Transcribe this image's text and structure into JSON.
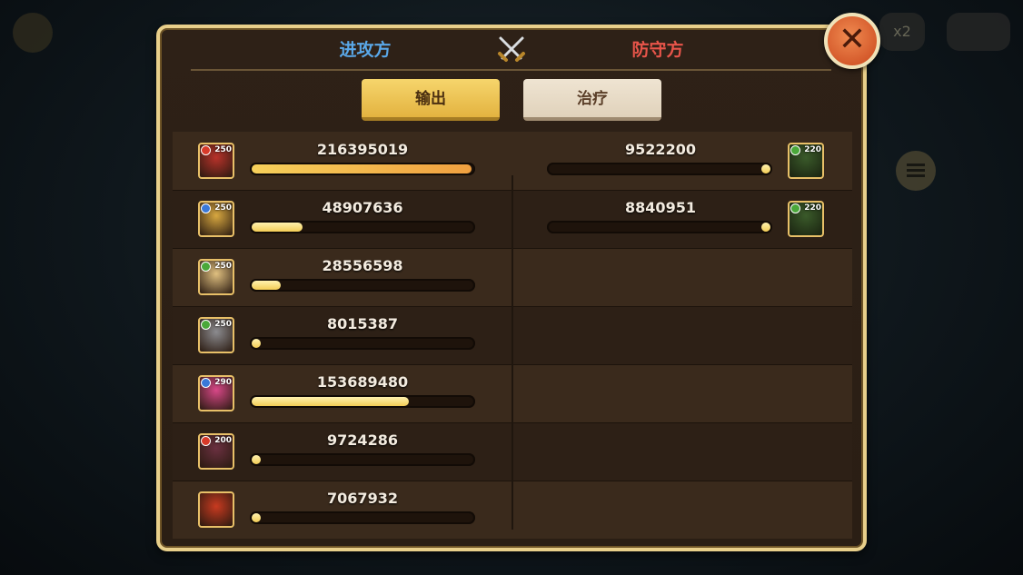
{
  "header": {
    "attacker_label": "进攻方",
    "defender_label": "防守方",
    "vs_icon": "crossed-swords-icon",
    "close_icon": "close-x-icon"
  },
  "background": {
    "speed_label": "x2"
  },
  "tabs": [
    {
      "label": "输出",
      "selected": true
    },
    {
      "label": "治疗",
      "selected": false
    }
  ],
  "attackers": [
    {
      "damage": "216395019",
      "level": "250",
      "element": "fire",
      "portrait_color": "#b8322a",
      "fill_fraction": 0.99,
      "fill_color": "#f0a040"
    },
    {
      "damage": "48907636",
      "level": "250",
      "element": "light",
      "portrait_color": "#d8a840",
      "fill_fraction": 0.23
    },
    {
      "damage": "28556598",
      "level": "250",
      "element": "nature",
      "portrait_color": "#e0c080",
      "fill_fraction": 0.13
    },
    {
      "damage": "8015387",
      "level": "250",
      "element": "nature",
      "portrait_color": "#8c8c90",
      "fill_fraction": 0.04
    },
    {
      "damage": "153689480",
      "level": "290",
      "element": "light",
      "portrait_color": "#d84888",
      "fill_fraction": 0.71
    },
    {
      "damage": "9724286",
      "level": "200",
      "element": "fire",
      "portrait_color": "#6a3040",
      "fill_fraction": 0.04
    },
    {
      "damage": "7067932",
      "level": "",
      "element": "",
      "portrait_color": "#c83a20",
      "fill_fraction": 0.04
    }
  ],
  "defenders": [
    {
      "damage": "9522200",
      "level": "220",
      "element": "nature",
      "portrait_color": "#3a5a2a",
      "fill_fraction": 0.04
    },
    {
      "damage": "8840951",
      "level": "220",
      "element": "nature",
      "portrait_color": "#3a5a2a",
      "fill_fraction": 0.04
    }
  ],
  "colors": {
    "attacker_title": "#5aa8e8",
    "defender_title": "#e8554a",
    "bar_fill": "#f3cd55",
    "panel_border": "#e8cf8a"
  }
}
